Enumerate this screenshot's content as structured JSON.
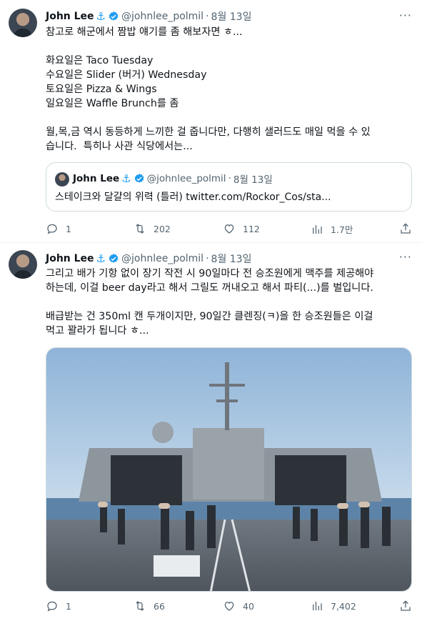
{
  "tweets": [
    {
      "author": {
        "name": "John Lee",
        "anchor": "⚓",
        "handle": "@johnlee_polmil",
        "date": "8월 13일"
      },
      "text": "참고로 해군에서 짬밥 얘기를 좀 해보자면 ㅎ...\n\n화요일은 Taco Tuesday\n수요일은 Slider (버거) Wednesday\n토요일은 Pizza & Wings\n일요일은 Waffle Brunch를 좀\n\n월,목,금 역시 동등하게 느끼한 걸 줍니다만, 다행히 샐러드도 매일 먹을 수 있\n습니다.  특히나 사관 식당에서는...",
      "quote": {
        "author": {
          "name": "John Lee",
          "anchor": "⚓",
          "handle": "@johnlee_polmil",
          "date": "8월 13일"
        },
        "text": "스테이크와 달걀의 위력 (틀러) twitter.com/Rockor_Cos/sta..."
      },
      "stats": {
        "replies": "1",
        "retweets": "202",
        "likes": "112",
        "views": "1.7만"
      }
    },
    {
      "author": {
        "name": "John Lee",
        "anchor": "⚓",
        "handle": "@johnlee_polmil",
        "date": "8월 13일"
      },
      "text": "그리고 배가 기항 없이 장기 작전 시 90일마다 전 승조원에게 맥주를 제공해야\n하는데, 이걸 beer day라고 해서 그릴도 꺼내오고 해서 파티(...)를 벌입니다.\n\n배급받는 건 350ml 캔 두개이지만, 90일간 클렌징(ㅋ)을 한 승조원들은 이걸\n먹고 꽐라가 됩니다 ㅎ...",
      "stats": {
        "replies": "1",
        "retweets": "66",
        "likes": "40",
        "views": "7,402"
      }
    }
  ],
  "ui": {
    "more_icon": "···",
    "verified_color": "#1d9bf0",
    "accent": "#1d9bf0"
  }
}
